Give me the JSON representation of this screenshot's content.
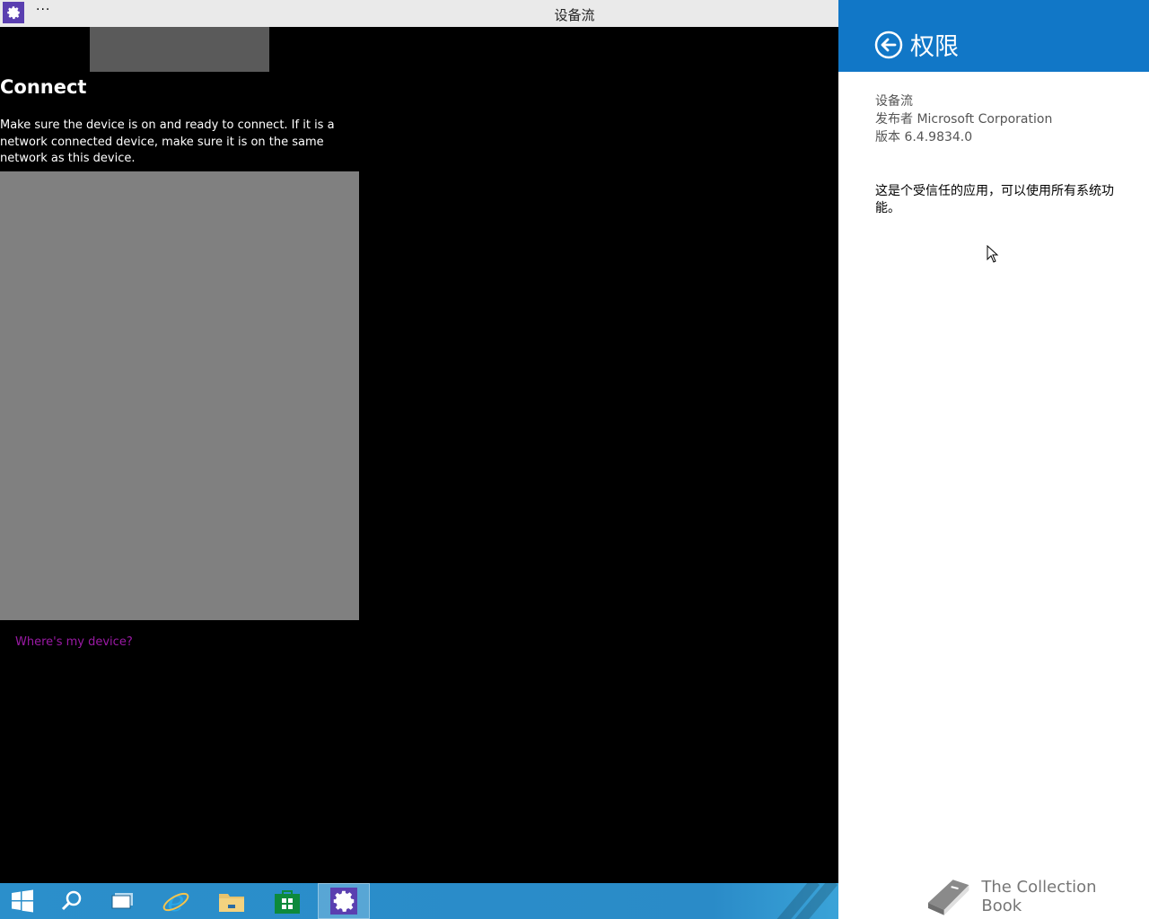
{
  "window": {
    "title": "设备流",
    "menu_label": "···"
  },
  "main": {
    "heading": "Connect",
    "description": "Make sure the device is on and ready to connect. If it is a network connected device, make sure it is on the same network as this device.",
    "help_link": "Where's my device?"
  },
  "taskbar": {
    "items": [
      {
        "icon": "windows-start-icon"
      },
      {
        "icon": "search-icon"
      },
      {
        "icon": "task-view-icon"
      },
      {
        "icon": "internet-explorer-icon"
      },
      {
        "icon": "file-explorer-icon"
      },
      {
        "icon": "store-icon"
      },
      {
        "icon": "settings-gear-icon",
        "active": true
      }
    ]
  },
  "panel": {
    "title": "权限",
    "app_name": "设备流",
    "publisher": "发布者 Microsoft Corporation",
    "version": "版本 6.4.9834.0",
    "trust_message": "这是个受信任的应用，可以使用所有系统功能。"
  },
  "watermark": {
    "text": "The Collection Book"
  },
  "colors": {
    "accent": "#1177c7",
    "link": "#9b1aa5",
    "taskbar": "#2b8fcb",
    "app_icon": "#5a3fb0"
  }
}
